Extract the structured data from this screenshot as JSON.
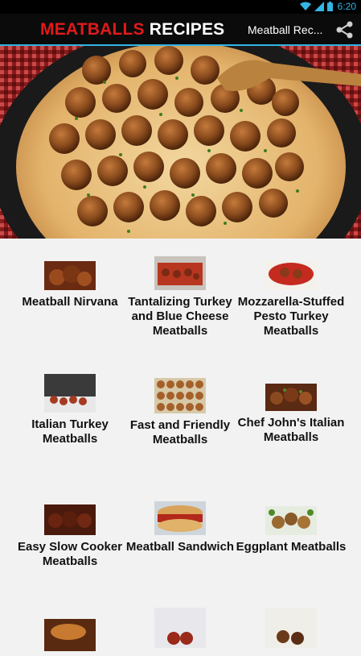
{
  "status_bar": {
    "time": "6:20"
  },
  "action_bar": {
    "brand_part1": "MEATBALLS",
    "brand_part2": "RECIPES",
    "title": "Meatball Rec...",
    "share_icon": "share-icon"
  },
  "hero": {
    "image": "meatballs-in-cream-sauce-photo"
  },
  "recipes": [
    {
      "name": "Meatball Nirvana"
    },
    {
      "name": "Tantalizing Turkey and Blue Cheese Meatballs"
    },
    {
      "name": "Mozzarella-Stuffed Pesto Turkey Meatballs"
    },
    {
      "name": "Italian Turkey Meatballs"
    },
    {
      "name": "Fast and Friendly Meatballs"
    },
    {
      "name": "Chef John's Italian Meatballs"
    },
    {
      "name": "Easy Slow Cooker Meatballs"
    },
    {
      "name": "Meatball Sandwich"
    },
    {
      "name": "Eggplant Meatballs"
    },
    {
      "name": ""
    },
    {
      "name": ""
    },
    {
      "name": ""
    }
  ],
  "colors": {
    "accent": "#33b5e5",
    "brand_red": "#e01a1a",
    "bar": "#0b0b0b",
    "background": "#f2f2f2"
  }
}
